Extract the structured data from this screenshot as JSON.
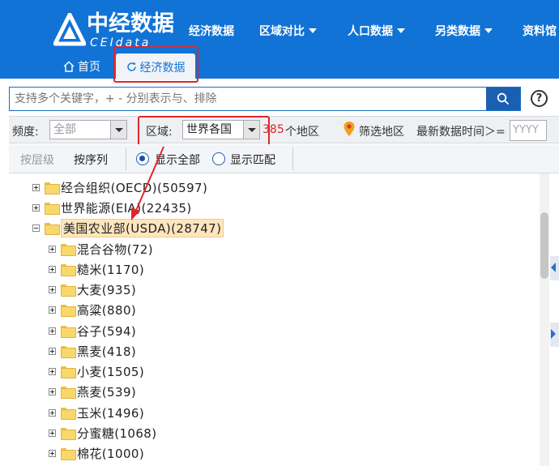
{
  "header": {
    "logo_cn": "中经数据",
    "logo_en": "CEIdata",
    "nav": [
      {
        "label": "经济数据",
        "dropdown": false
      },
      {
        "label": "区域对比",
        "dropdown": true
      },
      {
        "label": "人口数据",
        "dropdown": true
      },
      {
        "label": "另类数据",
        "dropdown": true
      },
      {
        "label": "资料馆",
        "dropdown": false
      }
    ],
    "tabs": {
      "home": "首页",
      "active": "经济数据"
    }
  },
  "search": {
    "placeholder": "支持多个关键字，+ - 分别表示与、排除"
  },
  "filters": {
    "frequency_label": "频度:",
    "frequency_value": "全部",
    "region_label": "区域:",
    "region_value": "世界各国",
    "region_count": "385",
    "region_count_suffix": "个地区",
    "filter_region": "筛选地区",
    "latest_time_label": "最新数据时间＞=",
    "latest_time_placeholder": "YYYY"
  },
  "toolbar": {
    "by_level": "按层级",
    "by_sequence": "按序列",
    "show_all": "显示全部",
    "show_match": "显示匹配",
    "selected": "show_all"
  },
  "tree": [
    {
      "label": "经合组织(OECD)(50597)",
      "level": 0,
      "expanded": false,
      "selected": false
    },
    {
      "label": "世界能源(EIA)(22435)",
      "level": 0,
      "expanded": false,
      "selected": false
    },
    {
      "label": "美国农业部(USDA)(28747)",
      "level": 0,
      "expanded": true,
      "selected": true
    },
    {
      "label": "混合谷物(72)",
      "level": 1,
      "expanded": false,
      "selected": false
    },
    {
      "label": "糙米(1170)",
      "level": 1,
      "expanded": false,
      "selected": false
    },
    {
      "label": "大麦(935)",
      "level": 1,
      "expanded": false,
      "selected": false
    },
    {
      "label": "高粱(880)",
      "level": 1,
      "expanded": false,
      "selected": false
    },
    {
      "label": "谷子(594)",
      "level": 1,
      "expanded": false,
      "selected": false
    },
    {
      "label": "黑麦(418)",
      "level": 1,
      "expanded": false,
      "selected": false
    },
    {
      "label": "小麦(1505)",
      "level": 1,
      "expanded": false,
      "selected": false
    },
    {
      "label": "燕麦(539)",
      "level": 1,
      "expanded": false,
      "selected": false
    },
    {
      "label": "玉米(1496)",
      "level": 1,
      "expanded": false,
      "selected": false
    },
    {
      "label": "分蜜糖(1068)",
      "level": 1,
      "expanded": false,
      "selected": false
    },
    {
      "label": "棉花(1000)",
      "level": 1,
      "expanded": false,
      "selected": false
    }
  ],
  "colors": {
    "brand": "#1273d6",
    "highlight": "#e0262a",
    "selected_bg": "#fde6bd"
  }
}
